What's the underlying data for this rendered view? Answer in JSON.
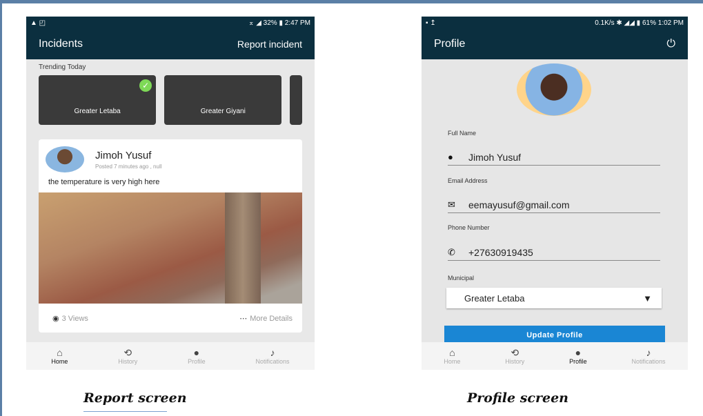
{
  "report_screen": {
    "status": {
      "left": "▲ ◰",
      "right": "⌅ ◢ 32% ▮ 2:47 PM"
    },
    "title": "Incidents",
    "action": "Report incident",
    "trending_label": "Trending Today",
    "trending": [
      {
        "label": "Greater Letaba",
        "selected": true
      },
      {
        "label": "Greater Giyani",
        "selected": false
      }
    ],
    "post": {
      "author": "Jimoh Yusuf",
      "meta": "Posted 7 minutes ago , null",
      "text": "the temperature is very high here",
      "views": "3 Views",
      "more": "More Details"
    },
    "nav": [
      {
        "label": "Home",
        "icon": "home-icon",
        "glyph": "⌂"
      },
      {
        "label": "History",
        "icon": "history-icon",
        "glyph": "⟲"
      },
      {
        "label": "Profile",
        "icon": "person-icon",
        "glyph": "●"
      },
      {
        "label": "Notifications",
        "icon": "bell-icon",
        "glyph": "♪"
      }
    ],
    "caption": "Report screen"
  },
  "profile_screen": {
    "status": {
      "left": "▪ ↥",
      "right": "0.1K/s ✱ ◢◢ ▮ 61% 1:02 PM"
    },
    "title": "Profile",
    "power_glyph": "⏻",
    "full_name_label": "Full Name",
    "full_name": "Jimoh Yusuf",
    "email_label": "Email Address",
    "email": "eemayusuf@gmail.com",
    "phone_label": "Phone Number",
    "phone": "+27630919435",
    "municipal_label": "Municipal",
    "municipal": "Greater Letaba",
    "update_button": "Update Profile",
    "nav": [
      {
        "label": "Home",
        "icon": "home-icon",
        "glyph": "⌂"
      },
      {
        "label": "History",
        "icon": "history-icon",
        "glyph": "⟲"
      },
      {
        "label": "Profile",
        "icon": "person-icon",
        "glyph": "●"
      },
      {
        "label": "Notifications",
        "icon": "bell-icon",
        "glyph": "♪"
      }
    ],
    "caption": "Profile screen"
  },
  "colors": {
    "appbar": "#0b2f3f",
    "button": "#1a86d4",
    "check": "#7ed957"
  }
}
